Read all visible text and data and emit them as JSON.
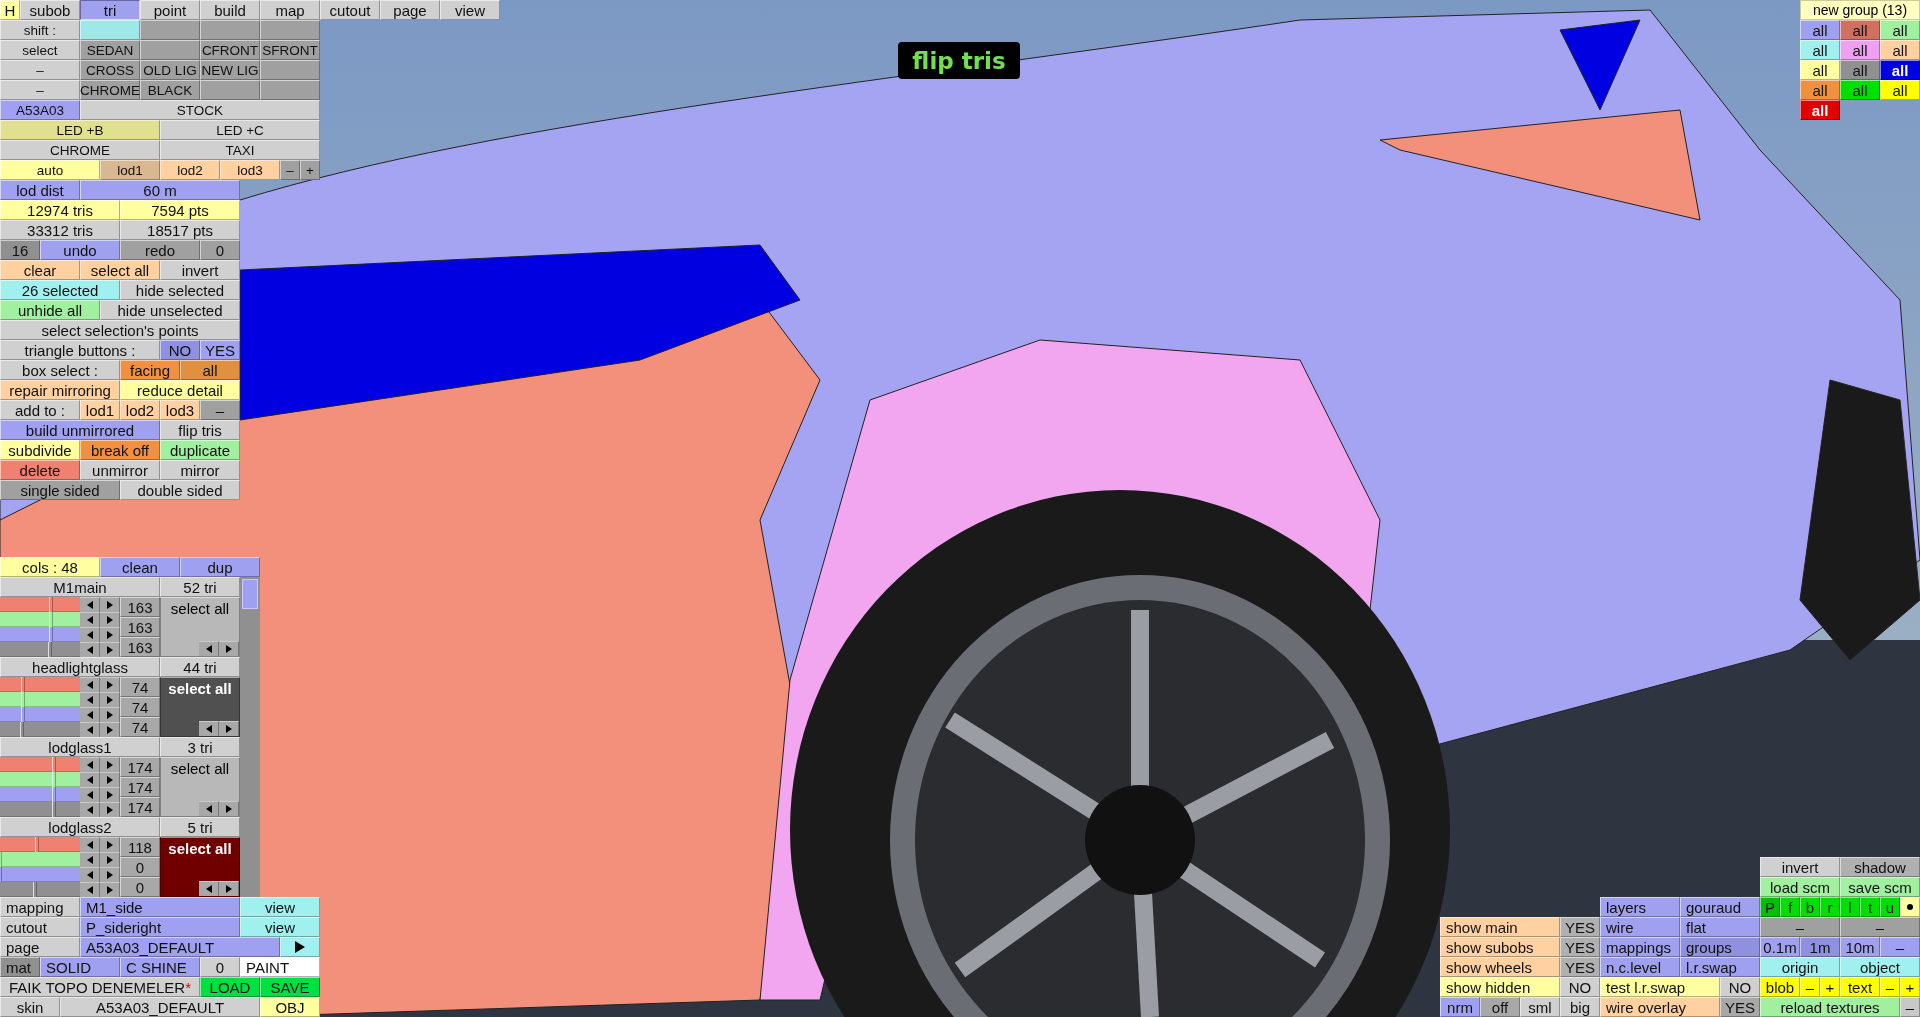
{
  "tool_panel": {
    "tabs": [
      {
        "text": "H",
        "color": "#ffffa0",
        "selected": false
      },
      {
        "text": "subob",
        "color": "#d0d0d0",
        "selected": false
      },
      {
        "text": "tri",
        "color": "#a0a0f0",
        "selected": true
      },
      {
        "text": "point",
        "color": "#d0d0d0",
        "selected": false
      },
      {
        "text": "build",
        "color": "#d0d0d0",
        "selected": false
      },
      {
        "text": "map",
        "color": "#d0d0d0",
        "selected": false
      },
      {
        "text": "cutout",
        "color": "#d0d0d0",
        "selected": false
      },
      {
        "text": "page",
        "color": "#d0d0d0",
        "selected": false
      },
      {
        "text": "view",
        "color": "#d0d0d0",
        "selected": false
      }
    ],
    "rows": [
      {
        "cells": [
          {
            "text": "shift :",
            "color": "#d0d0d0"
          },
          {
            "color": "#a0e8e8"
          },
          {
            "color": "#a0a0a0"
          },
          {
            "color": "#a0a0a0"
          },
          {
            "color": "#a0a0a0"
          }
        ]
      },
      {
        "cells": [
          {
            "text": "select",
            "color": "#d0d0d0"
          },
          {
            "text": "SEDAN",
            "color": "#a0a0a0"
          },
          {
            "color": "#a0a0a0"
          },
          {
            "text": "CFRONT",
            "color": "#a0a0a0"
          },
          {
            "text": "SFRONT",
            "color": "#a0a0a0"
          }
        ]
      },
      {
        "cells": [
          {
            "text": "–",
            "color": "#d0d0d0"
          },
          {
            "text": "CROSS",
            "color": "#a0a0a0"
          },
          {
            "text": "OLD LIG",
            "color": "#a0a0a0"
          },
          {
            "text": "NEW LIG",
            "color": "#a0a0a0"
          },
          {
            "color": "#a0a0a0"
          }
        ]
      },
      {
        "cells": [
          {
            "text": "–",
            "color": "#d0d0d0"
          },
          {
            "text": "CHROME",
            "color": "#a0a0a0"
          },
          {
            "text": "BLACK",
            "color": "#a0a0a0"
          },
          {
            "color": "#a0a0a0"
          },
          {
            "color": "#a0a0a0"
          }
        ]
      },
      {
        "cells": [
          {
            "text": "A53A03",
            "color": "#a0a0f0"
          },
          {
            "text": "STOCK",
            "color": "#d0d0d0"
          }
        ]
      },
      {
        "cells": [
          {
            "text": "LED +B",
            "color": "#e0e090"
          },
          {
            "text": "LED +C",
            "color": "#d0d0d0"
          }
        ]
      },
      {
        "cells": [
          {
            "text": "CHROME",
            "color": "#d0d0d0"
          },
          {
            "text": "TAXI",
            "color": "#d0d0d0"
          }
        ]
      },
      {
        "cells": [
          {
            "text": "auto",
            "color": "#ffffa0"
          },
          {
            "text": "lod1",
            "color": "#d8b890"
          },
          {
            "text": "lod2",
            "color": "#ffd0a0"
          },
          {
            "text": "lod3",
            "color": "#ffd0a0"
          },
          {
            "text": "–",
            "color": "#a0a0a0"
          },
          {
            "text": "+",
            "color": "#a0a0a0"
          }
        ]
      }
    ],
    "edit_rows": [
      {
        "cells": [
          {
            "text": "lod dist",
            "color": "#a0a0f0"
          },
          {
            "text": "60 m",
            "color": "#a0a0f0"
          }
        ]
      },
      {
        "cells": [
          {
            "text": "12974 tris",
            "color": "#ffffa0"
          },
          {
            "text": "7594 pts",
            "color": "#ffffa0"
          }
        ]
      },
      {
        "cells": [
          {
            "text": "33312 tris",
            "color": "#d0d0d0"
          },
          {
            "text": "18517 pts",
            "color": "#d0d0d0"
          }
        ]
      },
      {
        "cells": [
          {
            "text": "16",
            "color": "#909090"
          },
          {
            "text": "undo",
            "color": "#a0a0f0"
          },
          {
            "text": "redo",
            "color": "#a0a0a0"
          },
          {
            "text": "0",
            "color": "#a0a0a0"
          }
        ]
      },
      {
        "cells": [
          {
            "text": "clear",
            "color": "#ffd0a0"
          },
          {
            "text": "select all",
            "color": "#ffd0a0"
          },
          {
            "text": "invert",
            "color": "#d0d0d0"
          }
        ]
      },
      {
        "cells": [
          {
            "text": "26 selected",
            "color": "#a0f0f0"
          },
          {
            "text": "hide selected",
            "color": "#d0d0d0"
          }
        ]
      },
      {
        "cells": [
          {
            "text": "unhide all",
            "color": "#a0f0a0"
          },
          {
            "text": "hide unselected",
            "color": "#d0d0d0"
          }
        ]
      },
      {
        "cells": [
          {
            "text": "select selection's points",
            "color": "#d0d0d0"
          }
        ]
      },
      {
        "cells": [
          {
            "text": "triangle buttons :",
            "color": "#d0d0d0"
          },
          {
            "text": "NO",
            "color": "#9090e0"
          },
          {
            "text": "YES",
            "color": "#a0a0f0"
          }
        ]
      },
      {
        "cells": [
          {
            "text": "box select :",
            "color": "#d0d0d0"
          },
          {
            "text": "facing",
            "color": "#f09040"
          },
          {
            "text": "all",
            "color": "#e09040"
          }
        ]
      },
      {
        "cells": [
          {
            "text": "repair mirroring",
            "color": "#ffd0a0"
          },
          {
            "text": "reduce detail",
            "color": "#ffffa0"
          }
        ]
      },
      {
        "cells": [
          {
            "text": "add to :",
            "color": "#d0d0d0"
          },
          {
            "text": "lod1",
            "color": "#ffd0a0"
          },
          {
            "text": "lod2",
            "color": "#ffd0a0"
          },
          {
            "text": "lod3",
            "color": "#ffd0a0"
          },
          {
            "text": "–",
            "color": "#a0a0a0"
          }
        ]
      },
      {
        "cells": [
          {
            "text": "build unmirrored",
            "color": "#a0a0f0"
          },
          {
            "text": "flip tris",
            "color": "#d0d0d0"
          }
        ]
      },
      {
        "cells": [
          {
            "text": "subdivide",
            "color": "#ffffa0"
          },
          {
            "text": "break off",
            "color": "#f09040"
          },
          {
            "text": "duplicate",
            "color": "#a0f0a0"
          }
        ]
      },
      {
        "cells": [
          {
            "text": "delete",
            "color": "#f08070"
          },
          {
            "text": "unmirror",
            "color": "#d0d0d0"
          },
          {
            "text": "mirror",
            "color": "#d0d0d0"
          }
        ]
      },
      {
        "cells": [
          {
            "text": "single sided",
            "color": "#a0a0a0"
          },
          {
            "text": "double sided",
            "color": "#d0d0d0"
          }
        ]
      }
    ]
  },
  "group_panel": {
    "header": [
      {
        "text": "cols : 48",
        "color": "#ffffa0"
      },
      {
        "text": "clean",
        "color": "#a0a0f0"
      },
      {
        "text": "dup",
        "color": "#a0a0f0"
      }
    ],
    "groups": [
      {
        "name": "M1main",
        "tri_count": "52 tri",
        "sliders": [
          {
            "level": 0.64
          },
          {
            "level": 0.64
          },
          {
            "level": 0.64
          },
          {
            "level": 0.63
          }
        ],
        "values": [
          "163",
          "163",
          "163"
        ],
        "button": "select all",
        "color": "#b8b8b8"
      },
      {
        "name": "headlightglass",
        "tri_count": "44 tri",
        "sliders": [
          {
            "level": 0.29
          },
          {
            "level": 0.29
          },
          {
            "level": 0.29
          },
          {
            "level": 0.27
          }
        ],
        "values": [
          "74",
          "74",
          "74"
        ],
        "button": "select all",
        "color": "#505050"
      },
      {
        "name": "lodglass1",
        "tri_count": "3 tri",
        "sliders": [
          {
            "level": 0.68
          },
          {
            "level": 0.68
          },
          {
            "level": 0.68
          },
          {
            "level": 0.67
          }
        ],
        "values": [
          "174",
          "174",
          "174"
        ],
        "button": "select all",
        "color": "#b8b8b8"
      },
      {
        "name": "lodglass2",
        "tri_count": "5 tri",
        "sliders": [
          {
            "level": 0.46
          },
          {
            "level": 0
          },
          {
            "level": 0
          },
          {
            "level": 0.44
          }
        ],
        "values": [
          "118",
          "0",
          "0"
        ],
        "button": "select all",
        "color": "#700000"
      }
    ],
    "footer_rows": [
      {
        "cells": [
          {
            "text": "mapping",
            "color": "#d0d0d0"
          },
          {
            "text": "M1_side",
            "color": "#a0a0f0"
          },
          {
            "text": "view",
            "color": "#a0f0f0"
          }
        ]
      },
      {
        "cells": [
          {
            "text": "cutout",
            "color": "#d0d0d0"
          },
          {
            "text": "P_sideright",
            "color": "#a0a0f0"
          },
          {
            "text": "view",
            "color": "#a0f0f0"
          }
        ]
      },
      {
        "cells": [
          {
            "kind": "button",
            "text": "page",
            "color": "#d0d0d0"
          },
          {
            "kind": "button",
            "text": "A53A03_DEFAULT",
            "color": "#a0a0f0"
          },
          {
            "kind": "arrow",
            "color": "#a0f0f0"
          }
        ]
      },
      {
        "cells": [
          {
            "text": "mat",
            "color": "#909090"
          },
          {
            "text": "SOLID",
            "color": "#a0a0f0"
          },
          {
            "text": "C SHINE",
            "color": "#a0a0f0"
          },
          {
            "text": "0",
            "color": "#d0d0d0"
          },
          {
            "text": "PAINT",
            "color": "#ffffff"
          }
        ]
      },
      {
        "cells": [
          {
            "text": "FAIK TOPO DENEMELER",
            "suffix": "*",
            "color": "#d0d0d0"
          },
          {
            "text": "LOAD",
            "color": "#00e040"
          },
          {
            "text": "SAVE",
            "color": "#00e040"
          }
        ]
      },
      {
        "cells": [
          {
            "text": "skin",
            "color": "#d0d0d0"
          },
          {
            "text": "A53A03_DEFAULT",
            "color": "#d0d0d0"
          },
          {
            "text": "OBJ",
            "color": "#ffffa0"
          }
        ]
      }
    ]
  },
  "view_panel": {
    "left": [
      {
        "cells": [
          {
            "text": "show main",
            "color": "#ffd0a0"
          },
          {
            "text": "YES",
            "color": "#b0b0b0"
          }
        ]
      },
      {
        "cells": [
          {
            "text": "show subobs",
            "color": "#ffd0a0"
          },
          {
            "text": "YES",
            "color": "#b0b0b0"
          }
        ]
      },
      {
        "cells": [
          {
            "text": "show wheels",
            "color": "#ffd0a0"
          },
          {
            "text": "YES",
            "color": "#b0b0b0"
          }
        ]
      },
      {
        "cells": [
          {
            "text": "show hidden",
            "color": "#ffffa0"
          },
          {
            "text": "NO",
            "color": "#d0d0d0"
          }
        ]
      },
      {
        "cells": [
          {
            "text": "nrm",
            "color": "#a0a0f0"
          },
          {
            "text": "off",
            "color": "#a8a8a8"
          },
          {
            "text": "sml",
            "color": "#d0d0d0"
          },
          {
            "text": "big",
            "color": "#d0d0d0"
          }
        ]
      }
    ],
    "middle": [
      {
        "cells": [
          {
            "text": "layers",
            "color": "#a0a0f0"
          },
          {
            "text": "gouraud",
            "color": "#a0a0f0"
          }
        ]
      },
      {
        "cells": [
          {
            "text": "wire",
            "color": "#a0a0f0"
          },
          {
            "text": "flat",
            "color": "#a0a0f0"
          }
        ]
      },
      {
        "cells": [
          {
            "text": "mappings",
            "color": "#a0a0f0"
          },
          {
            "text": "groups",
            "color": "#9090e0"
          }
        ]
      },
      {
        "cells": [
          {
            "text": "n.c.level",
            "color": "#a0a0f0"
          },
          {
            "text": "l.r.swap",
            "color": "#a0a0f0"
          }
        ]
      },
      {
        "cells": [
          {
            "text": "test l.r.swap",
            "color": "#ffffa0"
          },
          {
            "text": "NO",
            "color": "#d0d0d0"
          }
        ]
      },
      {
        "cells": [
          {
            "text": "wire overlay",
            "color": "#ffd0a0"
          },
          {
            "text": "YES",
            "color": "#a8a8a8"
          }
        ]
      }
    ],
    "right": [
      {
        "cells": [
          {
            "text": "invert",
            "color": "#d0d0d0"
          },
          {
            "text": "shadow",
            "color": "#b0b0b0"
          }
        ]
      },
      {
        "cells": [
          {
            "text": "load scm",
            "color": "#a0f0a0"
          },
          {
            "text": "save scm",
            "color": "#a0f0a0"
          }
        ]
      },
      {
        "cells": [
          {
            "kind": "button",
            "text": "P",
            "color": "#00c000"
          },
          {
            "kind": "button",
            "text": "f",
            "color": "#00e000"
          },
          {
            "kind": "button",
            "text": "b",
            "color": "#00e000"
          },
          {
            "kind": "button",
            "text": "r",
            "color": "#00e000"
          },
          {
            "kind": "button",
            "text": "l",
            "color": "#00e000"
          },
          {
            "kind": "button",
            "text": "t",
            "color": "#00e000"
          },
          {
            "kind": "button",
            "text": "u",
            "color": "#00e000"
          },
          {
            "kind": "dot",
            "color": "#ffffa0"
          }
        ]
      },
      {
        "cells": [
          {
            "text": "–",
            "color": "#a0a0a0"
          },
          {
            "text": "–",
            "color": "#a0a0a0"
          }
        ]
      },
      {
        "cells": [
          {
            "text": "0.1m",
            "color": "#a0a0f0"
          },
          {
            "text": "1m",
            "color": "#9090e0"
          },
          {
            "text": "10m",
            "color": "#a0a0f0"
          },
          {
            "text": "–",
            "color": "#a0a0f0"
          }
        ]
      },
      {
        "cells": [
          {
            "text": "origin",
            "color": "#a0f0f0"
          },
          {
            "text": "object",
            "color": "#a0f0f0"
          }
        ]
      },
      {
        "cells": [
          {
            "text": "blob",
            "color": "#ffff00"
          },
          {
            "text": "–",
            "color": "#ffff00"
          },
          {
            "text": "+",
            "color": "#ffff00"
          },
          {
            "text": "text",
            "color": "#ffff00"
          },
          {
            "text": "–",
            "color": "#ffff00"
          },
          {
            "text": "+",
            "color": "#ffff00"
          }
        ]
      },
      {
        "cells": [
          {
            "text": "reload textures",
            "color": "#a0f0a0"
          },
          {
            "text": "–",
            "color": "#c8c8c8"
          }
        ]
      }
    ]
  },
  "group_colors": {
    "title": "new group (13)",
    "buttons": [
      {
        "text": "all",
        "color": "#a0a0f0"
      },
      {
        "text": "all",
        "color": "#d07060"
      },
      {
        "text": "all",
        "color": "#a0f0a0"
      },
      {
        "text": "all",
        "color": "#a0f0f0"
      },
      {
        "text": "all",
        "color": "#f0a0f0"
      },
      {
        "text": "all",
        "color": "#ffd0a0"
      },
      {
        "text": "all",
        "color": "#ffffa0"
      },
      {
        "text": "all",
        "color": "#909090"
      },
      {
        "text": "all",
        "color": "#0000e0"
      },
      {
        "text": "all",
        "color": "#f09040"
      },
      {
        "text": "all",
        "color": "#00e000"
      },
      {
        "text": "all",
        "color": "#ffff00"
      },
      {
        "text": "all",
        "color": "#e00000"
      }
    ]
  },
  "status_overlay": {
    "text": "flip tris"
  }
}
